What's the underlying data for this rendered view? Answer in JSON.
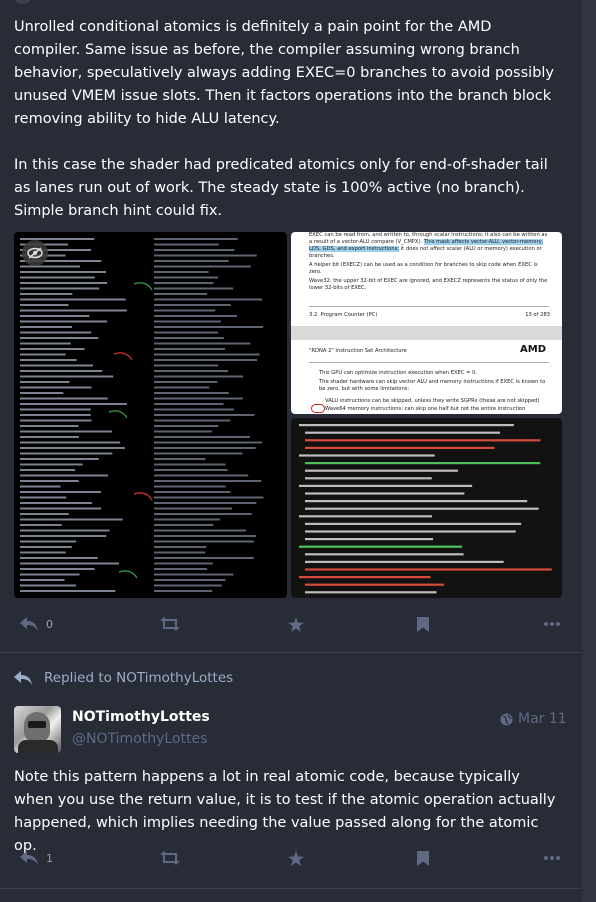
{
  "post1": {
    "paragraphs": [
      "Unrolled conditional atomics is definitely a pain point for the AMD compiler. Same issue as before, the compiler assuming wrong branch behavior, speculatively always adding EXEC=0 branches to avoid possibly unused VMEM issue slots. Then it factors operations into the branch block removing ability to hide ALU latency.",
      "In this case the shader had predicated atomics only for end-of-shader tail as lanes run out of work. The steady state is 100% active (no branch). Simple branch hint could fix."
    ],
    "reply_count": "0",
    "doc_text": {
      "line1": "EXEC can be read from, and written to, through scalar instructions; it also can be written as a result of a vector-ALU compare (V_CMPX).",
      "highlight": "This mask affects vector-ALU, vector-memory, LDS, GDS, and export instructions;",
      "line1b": "it does not affect scalar (ALU or memory) execution or branches.",
      "line2": "A helper bit (EXECZ) can be used as a condition for branches to skip code when EXEC is zero.",
      "line3": "Wave32: the upper 32-bit of EXEC are ignored, and EXECZ represents the status of only the lower 32-bits of EXEC.",
      "footer_left": "3.2. Program Counter (PC)",
      "footer_right": "13 of 283",
      "header_left": "\"RDNA 2\" Instruction Set Architecture",
      "brand": "AMD",
      "body1": "This GPU can optimize instruction execution when EXEC = 0.",
      "body2": "The shader hardware can skip vector ALU and memory instructions if EXEC is known to be zero, but with some limitations:",
      "bullet1": "VALU instructions can be skipped, unless they write SGPRs (these are not skipped)",
      "bullet2": "Wave64 memory instructions: can skip one half but not the entire instruction"
    }
  },
  "reply_note": "Replied to NOTimothyLottes",
  "post2": {
    "display_name": "NOTimothyLottes",
    "handle": "@NOTimothyLottes",
    "date": "Mar 11",
    "text": "Note this pattern happens a lot in real atomic code, because typically when you use the return value, it is to test if the atomic operation actually happened, which implies needing the value passed along for the atomic op.",
    "reply_count": "1"
  },
  "colors": {
    "background": "#282c37",
    "muted": "#606984",
    "link": "#9baec8"
  }
}
